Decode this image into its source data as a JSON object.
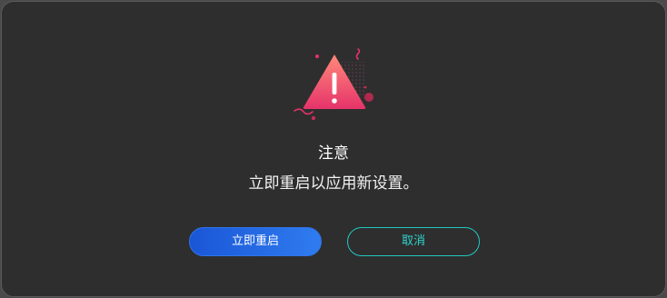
{
  "dialog": {
    "icon": "warning-triangle-icon",
    "title": "注意",
    "message": "立即重启以应用新设置。",
    "primary_button": "立即重启",
    "secondary_button": "取消"
  },
  "colors": {
    "background": "#2e2e2e",
    "primary_accent": "#2a6de6",
    "secondary_accent": "#22c9c1",
    "warning_gradient_top": "#ff7a7a",
    "warning_gradient_bottom": "#e8335f"
  }
}
